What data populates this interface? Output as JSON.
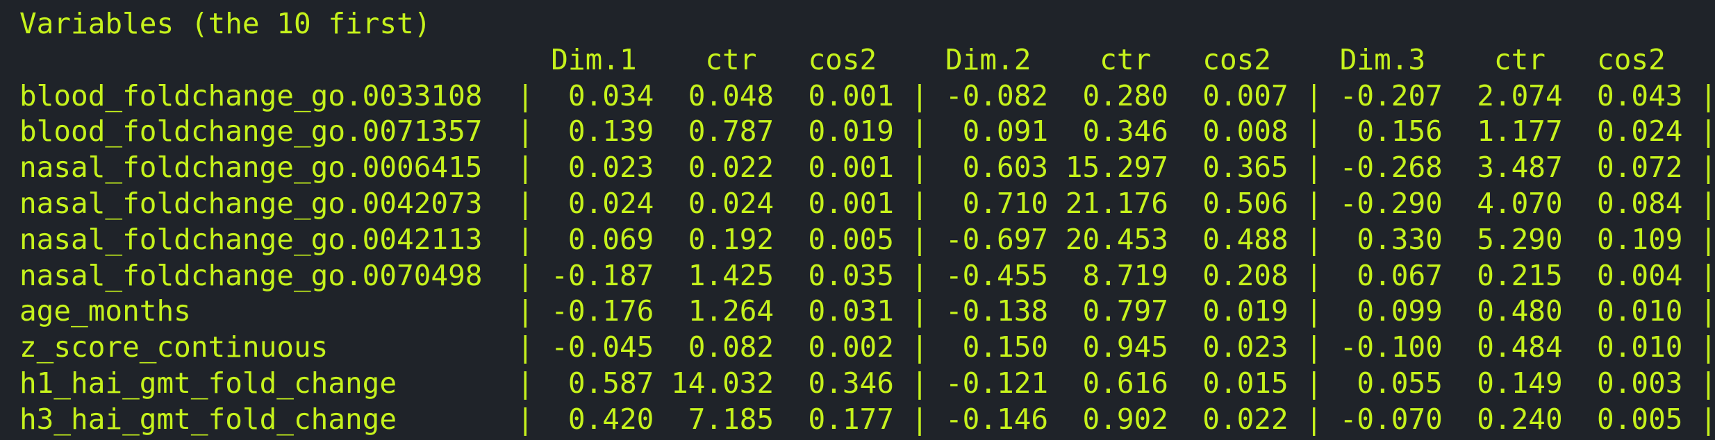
{
  "console": {
    "title": "Variables (the 10 first)",
    "columns": [
      "Dim.1",
      "ctr",
      "cos2",
      "Dim.2",
      "ctr",
      "cos2",
      "Dim.3",
      "ctr",
      "cos2"
    ],
    "separator": "|",
    "rows": [
      {
        "name": "blood_foldchange_go.0033108",
        "values": [
          "0.034",
          "0.048",
          "0.001",
          "-0.082",
          "0.280",
          "0.007",
          "-0.207",
          "2.074",
          "0.043"
        ]
      },
      {
        "name": "blood_foldchange_go.0071357",
        "values": [
          "0.139",
          "0.787",
          "0.019",
          "0.091",
          "0.346",
          "0.008",
          "0.156",
          "1.177",
          "0.024"
        ]
      },
      {
        "name": "nasal_foldchange_go.0006415",
        "values": [
          "0.023",
          "0.022",
          "0.001",
          "0.603",
          "15.297",
          "0.365",
          "-0.268",
          "3.487",
          "0.072"
        ]
      },
      {
        "name": "nasal_foldchange_go.0042073",
        "values": [
          "0.024",
          "0.024",
          "0.001",
          "0.710",
          "21.176",
          "0.506",
          "-0.290",
          "4.070",
          "0.084"
        ]
      },
      {
        "name": "nasal_foldchange_go.0042113",
        "values": [
          "0.069",
          "0.192",
          "0.005",
          "-0.697",
          "20.453",
          "0.488",
          "0.330",
          "5.290",
          "0.109"
        ]
      },
      {
        "name": "nasal_foldchange_go.0070498",
        "values": [
          "-0.187",
          "1.425",
          "0.035",
          "-0.455",
          "8.719",
          "0.208",
          "0.067",
          "0.215",
          "0.004"
        ]
      },
      {
        "name": "age_months",
        "values": [
          "-0.176",
          "1.264",
          "0.031",
          "-0.138",
          "0.797",
          "0.019",
          "0.099",
          "0.480",
          "0.010"
        ]
      },
      {
        "name": "z_score_continuous",
        "values": [
          "-0.045",
          "0.082",
          "0.002",
          "0.150",
          "0.945",
          "0.023",
          "-0.100",
          "0.484",
          "0.010"
        ]
      },
      {
        "name": "h1_hai_gmt_fold_change",
        "values": [
          "0.587",
          "14.032",
          "0.346",
          "-0.121",
          "0.616",
          "0.015",
          "0.055",
          "0.149",
          "0.003"
        ]
      },
      {
        "name": "h3_hai_gmt_fold_change",
        "values": [
          "0.420",
          "7.185",
          "0.177",
          "-0.146",
          "0.902",
          "0.022",
          "-0.070",
          "0.240",
          "0.005"
        ]
      }
    ]
  },
  "colors": {
    "background": "#1f2329",
    "text": "#c6f21c"
  }
}
